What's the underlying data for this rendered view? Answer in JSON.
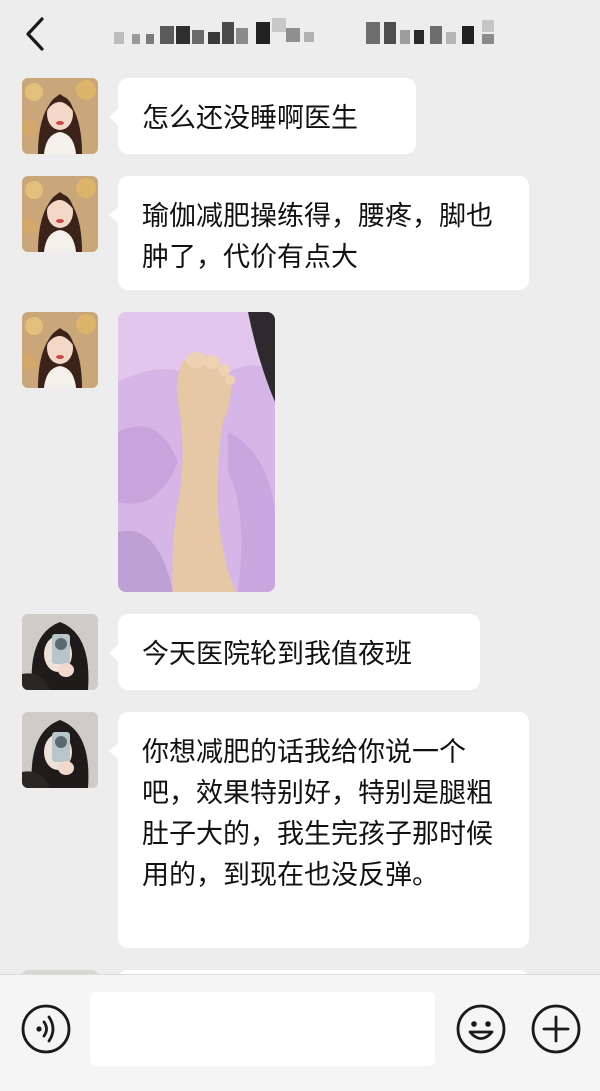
{
  "header": {
    "title": ""
  },
  "messages": [
    {
      "kind": "text",
      "avatar": "girl",
      "text": "怎么还没睡啊医生"
    },
    {
      "kind": "text",
      "avatar": "girl",
      "text": "瑜伽减肥操练得，腰疼，脚也肿了，代价有点大"
    },
    {
      "kind": "image",
      "avatar": "girl",
      "image": "swollen-foot-photo"
    },
    {
      "kind": "text",
      "avatar": "doctor",
      "text": "今天医院轮到我值夜班"
    },
    {
      "kind": "text",
      "avatar": "doctor",
      "text": "你想减肥的话我给你说一个吧，效果特别好，特别是腿粗肚子大的，我生完孩子那时候用的，到现在也没反弹。"
    }
  ],
  "input_bar": {
    "placeholder": ""
  },
  "icons": {
    "back": "back-chevron-icon",
    "voice": "voice-icon",
    "emoji": "emoji-icon",
    "plus": "plus-icon"
  },
  "colors": {
    "background": "#ededed",
    "bubble": "#ffffff",
    "text": "#111111",
    "icon": "#1a1a1a"
  }
}
